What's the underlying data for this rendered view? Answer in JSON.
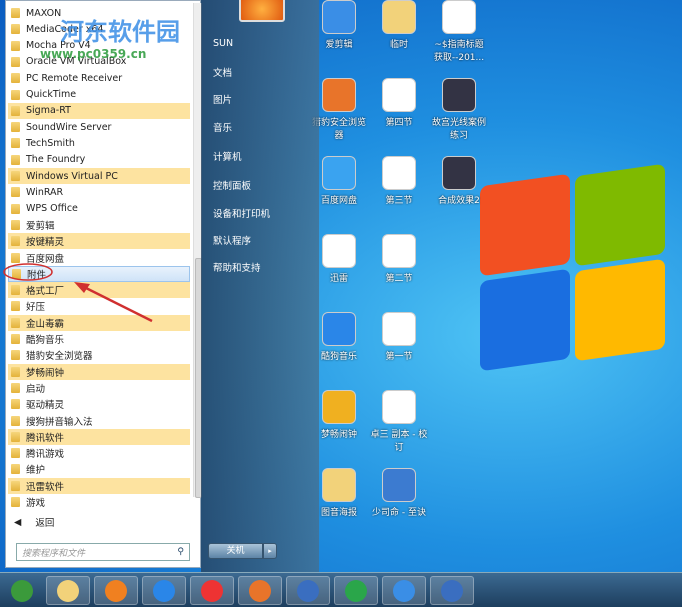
{
  "watermark": {
    "name": "河东软件园",
    "url": "www.pc0359.cn"
  },
  "programs": [
    {
      "label": "MAXON",
      "hl": false
    },
    {
      "label": "MediaCoder x64",
      "hl": false
    },
    {
      "label": "Mocha Pro V4",
      "hl": false
    },
    {
      "label": "Oracle VM VirtualBox",
      "hl": false
    },
    {
      "label": "PC Remote Receiver",
      "hl": false
    },
    {
      "label": "QuickTime",
      "hl": false
    },
    {
      "label": "Sigma-RT",
      "hl": true
    },
    {
      "label": "SoundWire Server",
      "hl": false
    },
    {
      "label": "TechSmith",
      "hl": false
    },
    {
      "label": "The Foundry",
      "hl": false
    },
    {
      "label": "Windows Virtual PC",
      "hl": true
    },
    {
      "label": "WinRAR",
      "hl": false
    },
    {
      "label": "WPS Office",
      "hl": false
    },
    {
      "label": "爱剪辑",
      "hl": false
    },
    {
      "label": "按键精灵",
      "hl": true
    },
    {
      "label": "百度网盘",
      "hl": false
    },
    {
      "label": "附件",
      "hl": false,
      "selected": true
    },
    {
      "label": "格式工厂",
      "hl": true
    },
    {
      "label": "好压",
      "hl": false
    },
    {
      "label": "金山毒霸",
      "hl": true
    },
    {
      "label": "酷狗音乐",
      "hl": false
    },
    {
      "label": "猎豹安全浏览器",
      "hl": false
    },
    {
      "label": "梦畅闹钟",
      "hl": true
    },
    {
      "label": "启动",
      "hl": false
    },
    {
      "label": "驱动精灵",
      "hl": false
    },
    {
      "label": "搜狗拼音输入法",
      "hl": false
    },
    {
      "label": "腾讯软件",
      "hl": true
    },
    {
      "label": "腾讯游戏",
      "hl": false
    },
    {
      "label": "维护",
      "hl": false
    },
    {
      "label": "迅雷软件",
      "hl": true
    },
    {
      "label": "游戏",
      "hl": false
    }
  ],
  "back_label": "返回",
  "search_placeholder": "搜索程序和文件",
  "right_items": [
    "SUN",
    "文档",
    "图片",
    "音乐",
    "计算机",
    "控制面板",
    "设备和打印机",
    "默认程序",
    "帮助和支持"
  ],
  "shutdown_label": "关机",
  "desktop_icons": [
    {
      "label": "爱剪辑",
      "color": "#3a8ee6"
    },
    {
      "label": "临时",
      "color": "#f2d27a"
    },
    {
      "label": "~$指南标题获取--201...",
      "color": "#fff"
    },
    {
      "label": "猎豹安全浏览器",
      "color": "#e8742a"
    },
    {
      "label": "第四节",
      "color": "#fff"
    },
    {
      "label": "故宫光线案例练习",
      "color": "#334"
    },
    {
      "label": "百度网盘",
      "color": "#3aa3f0"
    },
    {
      "label": "第三节",
      "color": "#fff"
    },
    {
      "label": "合成效果2",
      "color": "#334"
    },
    {
      "label": "迅雷",
      "color": "#fff"
    },
    {
      "label": "第二节",
      "color": "#fff"
    },
    {
      "label": "",
      "color": ""
    },
    {
      "label": "酷狗音乐",
      "color": "#2a86e8"
    },
    {
      "label": "第一节",
      "color": "#fff"
    },
    {
      "label": "",
      "color": ""
    },
    {
      "label": "梦畅闹钟",
      "color": "#f0b020"
    },
    {
      "label": "卓三 副本 - 校订",
      "color": "#fff"
    },
    {
      "label": "",
      "color": ""
    },
    {
      "label": "图音海报",
      "color": "#f2d27a"
    },
    {
      "label": "少司命 - 至诀",
      "color": "#3c7bd0"
    },
    {
      "label": "",
      "color": ""
    }
  ],
  "taskbar": [
    {
      "name": "start",
      "color": "#3b9a3b"
    },
    {
      "name": "explorer",
      "color": "#f2d27a"
    },
    {
      "name": "media-player",
      "color": "#f08020"
    },
    {
      "name": "kugou",
      "color": "#2a86e8"
    },
    {
      "name": "chrome",
      "color": "#e33"
    },
    {
      "name": "liebao",
      "color": "#e8742a"
    },
    {
      "name": "wps-writer",
      "color": "#3a6ec0"
    },
    {
      "name": "wps-sheet",
      "color": "#2aa64a"
    },
    {
      "name": "aijianji",
      "color": "#3a8ee6"
    },
    {
      "name": "wps",
      "color": "#3a6ec0"
    }
  ]
}
